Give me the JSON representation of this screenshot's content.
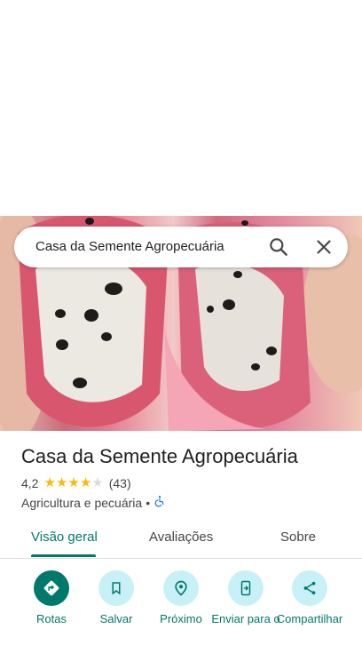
{
  "search": {
    "query": "Casa da Semente Agropecuária",
    "search_icon": "search-icon",
    "close_icon": "close-icon"
  },
  "place": {
    "title": "Casa da Semente Agropecuária",
    "rating": "4,2",
    "rating_value": 4.2,
    "stars_filled": 4,
    "review_count": "(43)",
    "category": "Agricultura e pecuária",
    "separator": "•",
    "accessibility_icon": "wheelchair-icon"
  },
  "tabs": [
    {
      "label": "Visão geral",
      "active": true
    },
    {
      "label": "Avaliações",
      "active": false
    },
    {
      "label": "Sobre",
      "active": false
    }
  ],
  "actions": [
    {
      "label": "Rotas",
      "icon": "directions-icon"
    },
    {
      "label": "Salvar",
      "icon": "bookmark-icon"
    },
    {
      "label": "Próximo",
      "icon": "nearby-icon"
    },
    {
      "label": "Enviar para o",
      "icon": "send-to-phone-icon"
    },
    {
      "label": "Compartilhar",
      "icon": "share-icon"
    }
  ],
  "colors": {
    "accent": "#00796b",
    "action_bg": "#c8f1f7",
    "star": "#fbbc04",
    "accessibility": "#1a73e8"
  }
}
